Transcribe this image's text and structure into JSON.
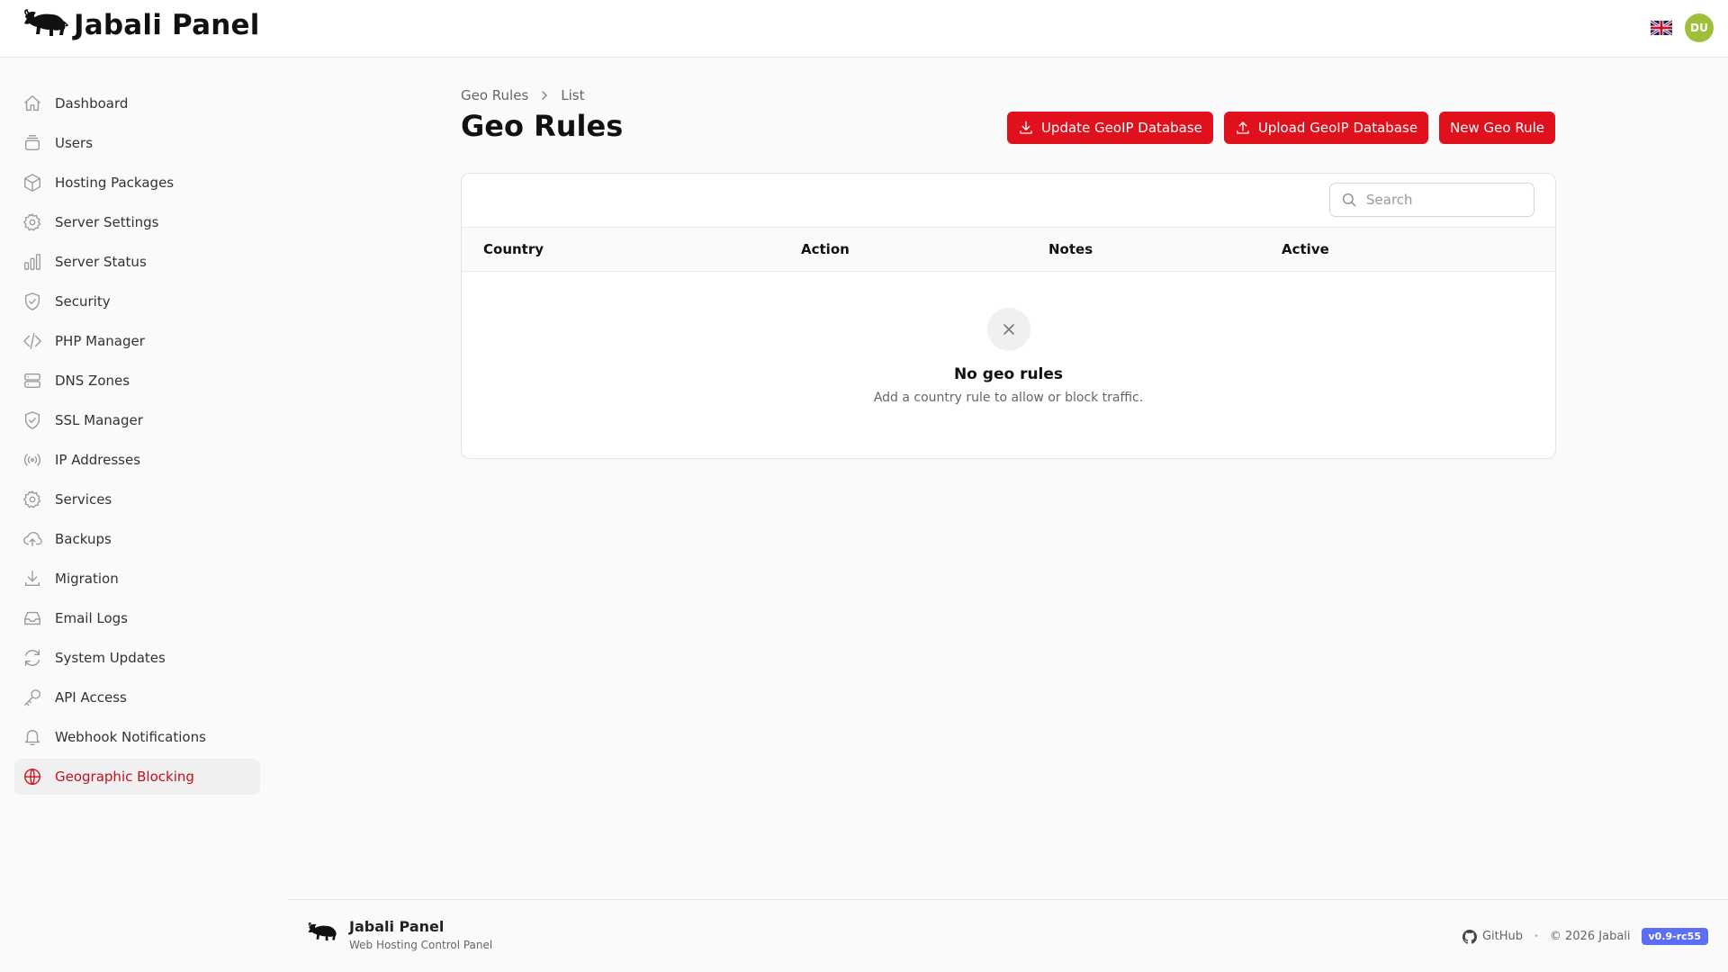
{
  "app": {
    "title": "Jabali Panel",
    "avatar_initials": "DU",
    "language_icon": "uk-flag-icon"
  },
  "sidebar": {
    "items": [
      {
        "label": "Dashboard",
        "icon": "home-icon"
      },
      {
        "label": "Users",
        "icon": "users-icon"
      },
      {
        "label": "Hosting Packages",
        "icon": "cube-icon"
      },
      {
        "label": "Server Settings",
        "icon": "gear-icon"
      },
      {
        "label": "Server Status",
        "icon": "bar-chart-icon"
      },
      {
        "label": "Security",
        "icon": "shield-icon"
      },
      {
        "label": "PHP Manager",
        "icon": "code-icon"
      },
      {
        "label": "DNS Zones",
        "icon": "server-icon"
      },
      {
        "label": "SSL Manager",
        "icon": "shield-check-icon"
      },
      {
        "label": "IP Addresses",
        "icon": "signal-icon"
      },
      {
        "label": "Services",
        "icon": "cog-icon"
      },
      {
        "label": "Backups",
        "icon": "cloud-upload-icon"
      },
      {
        "label": "Migration",
        "icon": "download-icon"
      },
      {
        "label": "Email Logs",
        "icon": "inbox-icon"
      },
      {
        "label": "System Updates",
        "icon": "refresh-icon"
      },
      {
        "label": "API Access",
        "icon": "key-icon"
      },
      {
        "label": "Webhook Notifications",
        "icon": "bell-icon"
      },
      {
        "label": "Geographic Blocking",
        "icon": "globe-icon",
        "active": true
      }
    ]
  },
  "breadcrumb": {
    "root": "Geo Rules",
    "current": "List"
  },
  "page": {
    "title": "Geo Rules"
  },
  "actions": {
    "update_label": "Update GeoIP Database",
    "upload_label": "Upload GeoIP Database",
    "new_label": "New Geo Rule"
  },
  "search": {
    "placeholder": "Search",
    "value": ""
  },
  "table": {
    "columns": [
      "Country",
      "Action",
      "Notes",
      "Active"
    ],
    "empty_title": "No geo rules",
    "empty_subtitle": "Add a country rule to allow or block traffic."
  },
  "footer": {
    "name": "Jabali Panel",
    "tagline": "Web Hosting Control Panel",
    "github_label": "GitHub",
    "separator": "•",
    "copyright": "© 2026 Jabali",
    "version": "v0.9-rc55"
  },
  "colors": {
    "accent": "#e0101c",
    "active_text": "#c2101d",
    "avatar": "#9fbf3b",
    "version_badge": "#5b6ef5"
  }
}
